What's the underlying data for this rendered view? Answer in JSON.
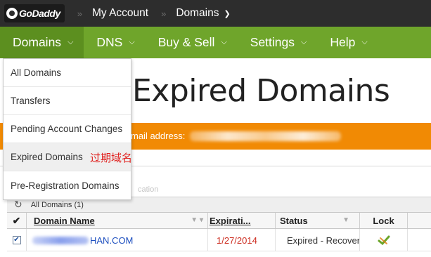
{
  "topbar": {
    "logo_text": "GoDaddy",
    "breadcrumb": [
      {
        "label": "My Account"
      },
      {
        "label": "Domains"
      }
    ],
    "separator": "»"
  },
  "nav": {
    "items": [
      {
        "label": "Domains"
      },
      {
        "label": "DNS"
      },
      {
        "label": "Buy & Sell"
      },
      {
        "label": "Settings"
      },
      {
        "label": "Help"
      }
    ]
  },
  "dropdown": {
    "items": [
      {
        "label": "All Domains"
      },
      {
        "label": "Transfers"
      },
      {
        "label": "Pending Account Changes"
      },
      {
        "label": "Expired Domains"
      },
      {
        "label": "Pre-Registration Domains"
      }
    ],
    "annotation": "过期域名"
  },
  "page": {
    "title": "Expired Domains",
    "notice": "mail address:",
    "faint_text": "cation"
  },
  "grid": {
    "toolbar_label": "All Domains (1)",
    "columns": [
      "Domain Name",
      "Expirati...",
      "Status",
      "Lock"
    ],
    "rows": [
      {
        "domain_suffix": "HAN.COM",
        "expiration": "1/27/2014",
        "status": "Expired - Recovera"
      }
    ]
  },
  "colors": {
    "topbar": "#2d2d2d",
    "nav_green": "#6fa52b",
    "notice_orange": "#f18a04",
    "link_blue": "#1d4fbf",
    "date_red": "#cc2a1e",
    "annotation_red": "#e0201d"
  }
}
